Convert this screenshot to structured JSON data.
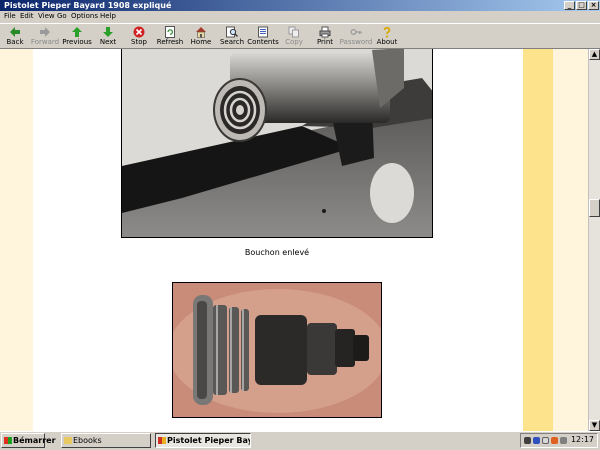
{
  "window": {
    "title": "Pistolet Pieper Bayard 1908 expliqué",
    "controls": [
      "_",
      "□",
      "×"
    ]
  },
  "menu": [
    "File",
    "Edit",
    "View",
    "Go",
    "Options",
    "Help"
  ],
  "toolbar": [
    {
      "label": "Back",
      "icon": "back-arrow-icon",
      "enabled": true
    },
    {
      "label": "Forward",
      "icon": "forward-arrow-icon",
      "enabled": false
    },
    {
      "label": "Previous",
      "icon": "up-arrow-icon",
      "enabled": true
    },
    {
      "label": "Next",
      "icon": "down-arrow-icon",
      "enabled": true
    },
    {
      "label": "Stop",
      "icon": "stop-icon",
      "enabled": true
    },
    {
      "label": "Refresh",
      "icon": "refresh-icon",
      "enabled": true
    },
    {
      "label": "Home",
      "icon": "home-icon",
      "enabled": true
    },
    {
      "label": "Search",
      "icon": "search-icon",
      "enabled": true
    },
    {
      "label": "Contents",
      "icon": "contents-icon",
      "enabled": true
    },
    {
      "label": "Copy",
      "icon": "copy-icon",
      "enabled": false
    },
    {
      "label": "Print",
      "icon": "print-icon",
      "enabled": true
    },
    {
      "label": "Password",
      "icon": "password-icon",
      "enabled": false
    },
    {
      "label": "About",
      "icon": "about-icon",
      "enabled": true
    }
  ],
  "content": {
    "caption": "Bouchon enlevé",
    "colors": {
      "background": "#ffffff",
      "stripe_gold": "#fde38c",
      "stripe_cream": "#fff5dc"
    }
  },
  "taskbar": {
    "start_label": "Bémarrer",
    "tasks": [
      {
        "label": "Ebooks",
        "active": false
      },
      {
        "label": "Pistolet Pieper Bayard...",
        "active": true
      }
    ],
    "clock": "12:17"
  }
}
